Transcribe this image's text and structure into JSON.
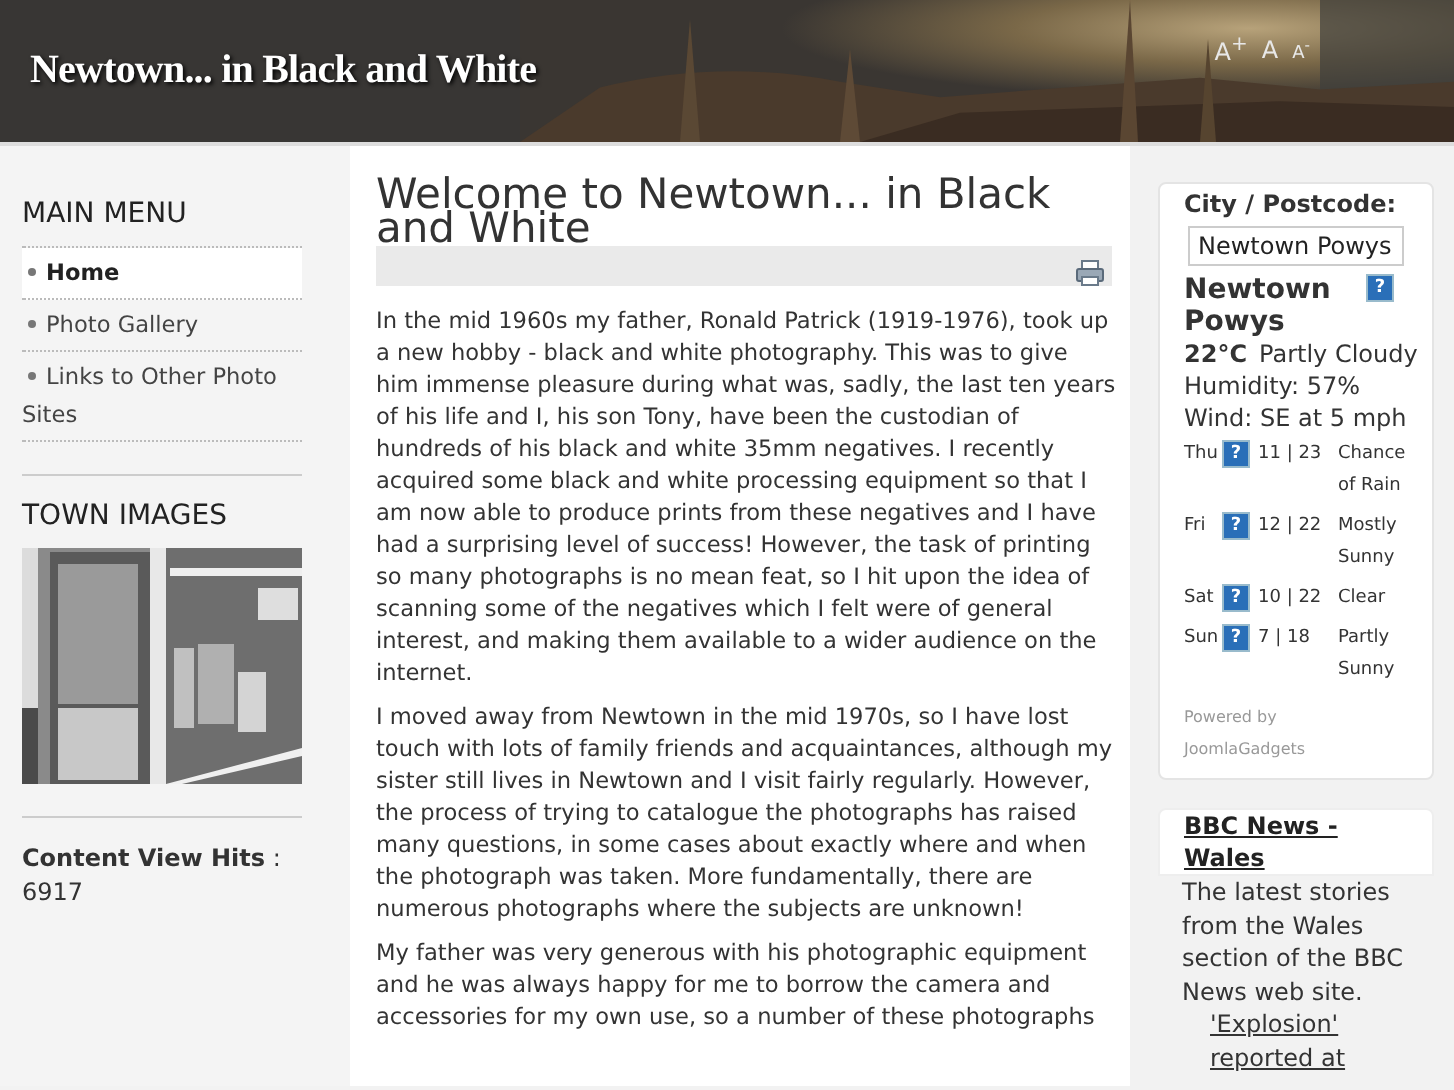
{
  "header": {
    "site_title": "Newtown... in Black and White",
    "font_sizes": [
      "A$^{+}$",
      "A",
      "A$^{-}$"
    ]
  },
  "main_menu": {
    "title": "MAIN MENU",
    "items": [
      {
        "label": "Home",
        "selected": true
      },
      {
        "label": "Photo Gallery",
        "selected": false
      },
      {
        "label": "Links to Other Photo Sites",
        "selected": false
      }
    ]
  },
  "town_images": {
    "title": "TOWN IMAGES"
  },
  "hits": {
    "label": "Content View Hits",
    "separator": ":",
    "value": "6917"
  },
  "article": {
    "title": "Welcome to Newtown... in Black and White",
    "paragraphs": [
      "In the mid 1960s my father, Ronald Patrick (1919-1976), took up a new hobby - black and white photography.  This was to give him immense pleasure during what was, sadly, the last ten years of his life and I, his son Tony, have been the custodian of hundreds of his black and white 35mm negatives.  I recently acquired some black and white processing equipment so that I am now able to produce prints from these negatives and I have had a surprising level of success!  However, the task of printing so many photographs is no mean feat, so I hit upon the idea of scanning some of the negatives which I felt were of general interest, and making them available to a wider audience on the internet.",
      "I moved away from Newtown in the mid 1970s, so I have lost touch with lots of family friends and acquaintances, although my sister still lives in Newtown and I visit fairly regularly.  However, the process of trying to catalogue the photographs has raised many questions, in some cases about exactly where and when the photograph was taken.  More fundamentally, there are numerous photographs where the subjects are unknown!",
      "My father was very generous with his photographic equipment and he was always happy for me to borrow the camera and accessories for my own use, so a number of these photographs"
    ]
  },
  "weather": {
    "label": "City / Postcode:",
    "city_value": "Newtown Powys",
    "location": "Newtown Powys",
    "icon_glyph": "?",
    "temperature": "22°C",
    "condition": "Partly Cloudy",
    "humidity": "Humidity: 57%",
    "wind": "Wind: SE at 5 mph",
    "forecast": [
      {
        "day": "Thu",
        "icon_glyph": "?",
        "temps": "11 | 23",
        "condition": "Chance of Rain"
      },
      {
        "day": "Fri",
        "icon_glyph": "?",
        "temps": "12 | 22",
        "condition": "Mostly Sunny"
      },
      {
        "day": "Sat",
        "icon_glyph": "?",
        "temps": "10 | 22",
        "condition": "Clear"
      },
      {
        "day": "Sun",
        "icon_glyph": "?",
        "temps": "7 | 18",
        "condition": "Partly Sunny"
      }
    ],
    "powered_by": "Powered by JoomlaGadgets"
  },
  "news": {
    "title": "BBC News - Wales",
    "description": "The latest stories from the Wales section of the BBC News web site.",
    "items": [
      "'Explosion' reported at"
    ]
  }
}
